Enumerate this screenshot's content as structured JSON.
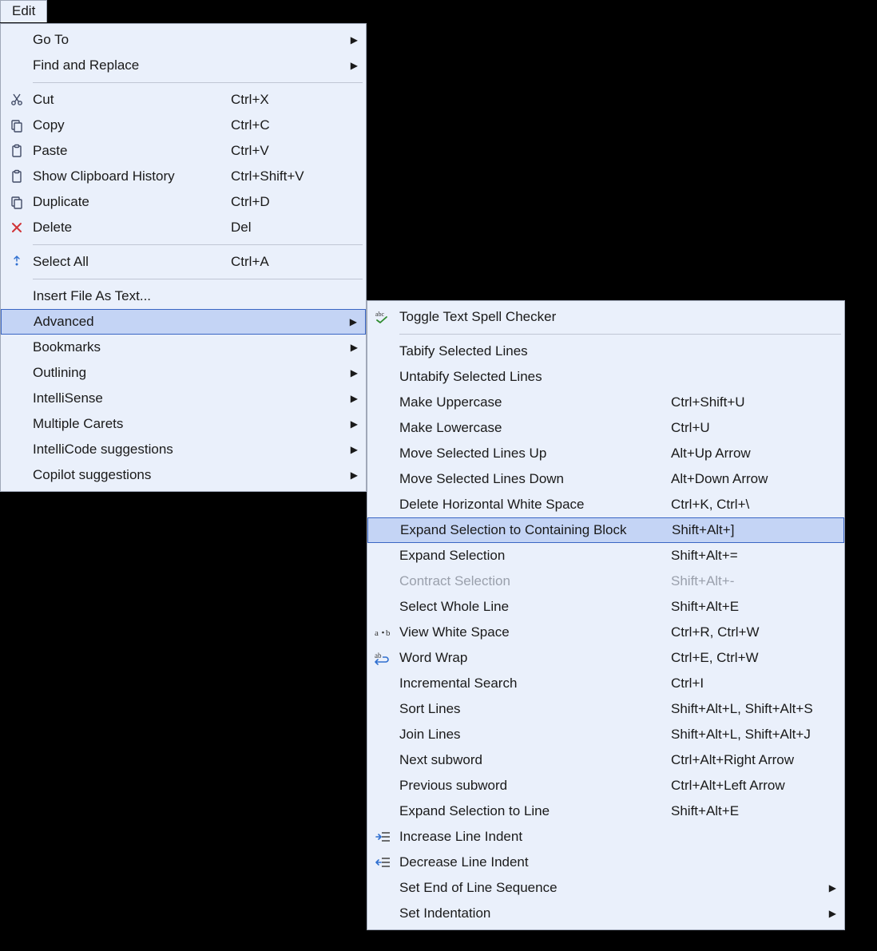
{
  "edit_menu": {
    "title": "Edit",
    "items": [
      {
        "label": "Go To",
        "submenu": true
      },
      {
        "label": "Find and Replace",
        "submenu": true
      },
      {
        "separator": true
      },
      {
        "label": "Cut",
        "shortcut": "Ctrl+X",
        "icon": "cut"
      },
      {
        "label": "Copy",
        "shortcut": "Ctrl+C",
        "icon": "copy"
      },
      {
        "label": "Paste",
        "shortcut": "Ctrl+V",
        "icon": "paste"
      },
      {
        "label": "Show Clipboard History",
        "shortcut": "Ctrl+Shift+V",
        "icon": "clipboard-history"
      },
      {
        "label": "Duplicate",
        "shortcut": "Ctrl+D",
        "icon": "duplicate"
      },
      {
        "label": "Delete",
        "shortcut": "Del",
        "icon": "delete"
      },
      {
        "separator": true
      },
      {
        "label": "Select All",
        "shortcut": "Ctrl+A",
        "icon": "select-all"
      },
      {
        "separator": true
      },
      {
        "label": "Insert File As Text..."
      },
      {
        "label": "Advanced",
        "submenu": true,
        "highlight": true
      },
      {
        "label": "Bookmarks",
        "submenu": true
      },
      {
        "label": "Outlining",
        "submenu": true
      },
      {
        "label": "IntelliSense",
        "submenu": true
      },
      {
        "label": "Multiple Carets",
        "submenu": true
      },
      {
        "label": "IntelliCode suggestions",
        "submenu": true
      },
      {
        "label": "Copilot suggestions",
        "submenu": true
      }
    ]
  },
  "advanced_menu": {
    "items": [
      {
        "label": "Toggle Text Spell Checker",
        "icon": "spellcheck"
      },
      {
        "separator": true
      },
      {
        "label": "Tabify Selected Lines"
      },
      {
        "label": "Untabify Selected Lines"
      },
      {
        "label": "Make Uppercase",
        "shortcut": "Ctrl+Shift+U"
      },
      {
        "label": "Make Lowercase",
        "shortcut": "Ctrl+U"
      },
      {
        "label": "Move Selected Lines Up",
        "shortcut": "Alt+Up Arrow"
      },
      {
        "label": "Move Selected Lines Down",
        "shortcut": "Alt+Down Arrow"
      },
      {
        "label": "Delete Horizontal White Space",
        "shortcut": "Ctrl+K, Ctrl+\\"
      },
      {
        "label": "Expand Selection to Containing Block",
        "shortcut": "Shift+Alt+]",
        "highlight": true
      },
      {
        "label": "Expand Selection",
        "shortcut": "Shift+Alt+="
      },
      {
        "label": "Contract Selection",
        "shortcut": "Shift+Alt+-",
        "disabled": true
      },
      {
        "label": "Select Whole Line",
        "shortcut": "Shift+Alt+E"
      },
      {
        "label": "View White Space",
        "shortcut": "Ctrl+R, Ctrl+W",
        "icon": "whitespace"
      },
      {
        "label": "Word Wrap",
        "shortcut": "Ctrl+E, Ctrl+W",
        "icon": "wordwrap"
      },
      {
        "label": "Incremental Search",
        "shortcut": "Ctrl+I"
      },
      {
        "label": "Sort Lines",
        "shortcut": "Shift+Alt+L, Shift+Alt+S"
      },
      {
        "label": "Join Lines",
        "shortcut": "Shift+Alt+L, Shift+Alt+J"
      },
      {
        "label": "Next subword",
        "shortcut": "Ctrl+Alt+Right Arrow"
      },
      {
        "label": "Previous subword",
        "shortcut": "Ctrl+Alt+Left Arrow"
      },
      {
        "label": "Expand Selection to Line",
        "shortcut": "Shift+Alt+E"
      },
      {
        "label": "Increase Line Indent",
        "icon": "indent"
      },
      {
        "label": "Decrease Line Indent",
        "icon": "outdent"
      },
      {
        "label": "Set End of Line Sequence",
        "submenu": true
      },
      {
        "label": "Set Indentation",
        "submenu": true
      }
    ]
  }
}
